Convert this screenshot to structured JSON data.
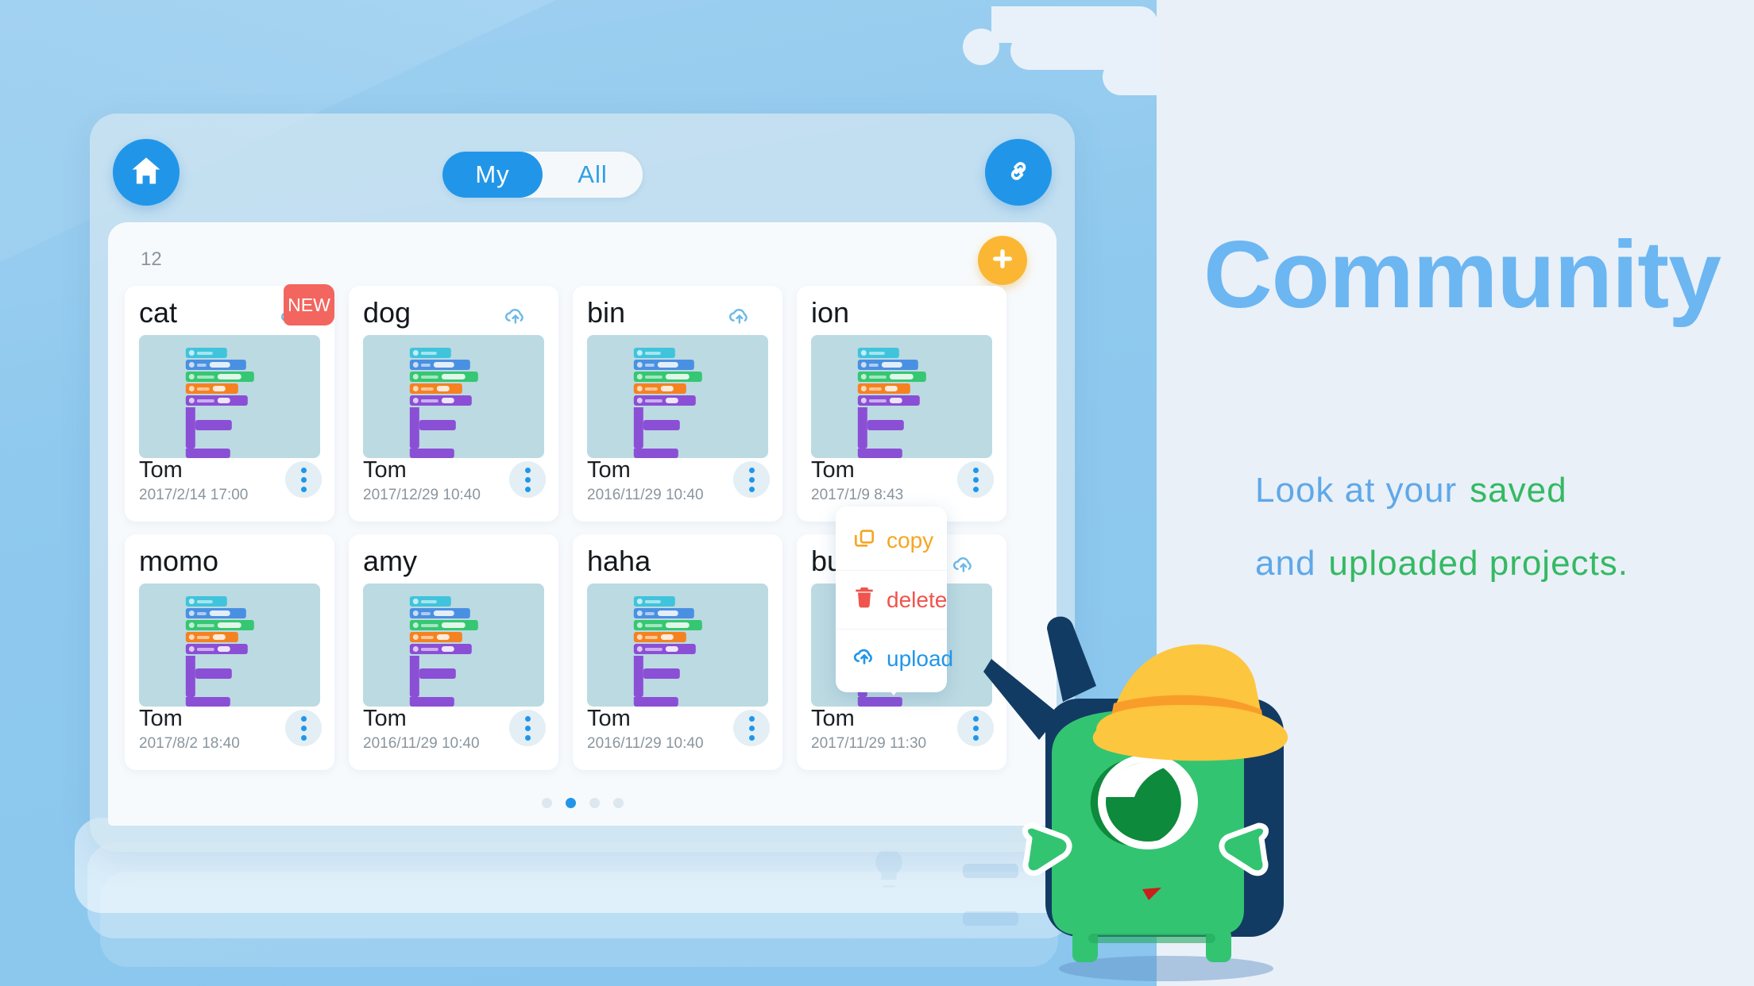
{
  "header": {
    "home_icon": "home-icon",
    "link_icon": "link-icon",
    "toggle": {
      "active_label": "My",
      "inactive_label": "All",
      "active_index": 0
    }
  },
  "toolbar": {
    "project_count": "12",
    "add_label": "+",
    "add_icon": "plus-icon"
  },
  "projects": [
    {
      "title": "cat",
      "author": "Tom",
      "date": "2017/2/14 17:00",
      "uploaded": true,
      "badge": "NEW"
    },
    {
      "title": "dog",
      "author": "Tom",
      "date": "2017/12/29 10:40",
      "uploaded": true,
      "badge": ""
    },
    {
      "title": "bin",
      "author": "Tom",
      "date": "2016/11/29 10:40",
      "uploaded": true,
      "badge": ""
    },
    {
      "title": "ion",
      "author": "Tom",
      "date": "2017/1/9 8:43",
      "uploaded": false,
      "badge": ""
    },
    {
      "title": "momo",
      "author": "Tom",
      "date": "2017/8/2 18:40",
      "uploaded": false,
      "badge": ""
    },
    {
      "title": "amy",
      "author": "Tom",
      "date": "2016/11/29 10:40",
      "uploaded": false,
      "badge": ""
    },
    {
      "title": "haha",
      "author": "Tom",
      "date": "2016/11/29 10:40",
      "uploaded": false,
      "badge": ""
    },
    {
      "title": "bug",
      "author": "Tom",
      "date": "2017/11/29 11:30",
      "uploaded": true,
      "badge": ""
    }
  ],
  "context_menu": {
    "items": [
      {
        "label": "copy",
        "icon": "copy-icon",
        "color": "#f5a623"
      },
      {
        "label": "delete",
        "icon": "trash-icon",
        "color": "#f0544c"
      },
      {
        "label": "upload",
        "icon": "cloud-upload-icon",
        "color": "#2196e8"
      }
    ]
  },
  "pagination": {
    "count": 4,
    "active": 1
  },
  "promo": {
    "title": "Community",
    "line1_part1": "Look  at  your",
    "line1_part2": "saved",
    "line2_part1": "and",
    "line2_part2": "uploaded  projects."
  },
  "colors": {
    "accent_blue": "#2196e8",
    "title_blue": "#6cb6f2",
    "text_blue": "#5fa8e8",
    "text_green": "#35b963",
    "badge_red": "#f2665f",
    "add_yellow": "#fbb733",
    "panel_bg": "#f7fafc",
    "page_bg_left": "#8fc9ee",
    "page_bg_right": "#e9f0f8"
  }
}
